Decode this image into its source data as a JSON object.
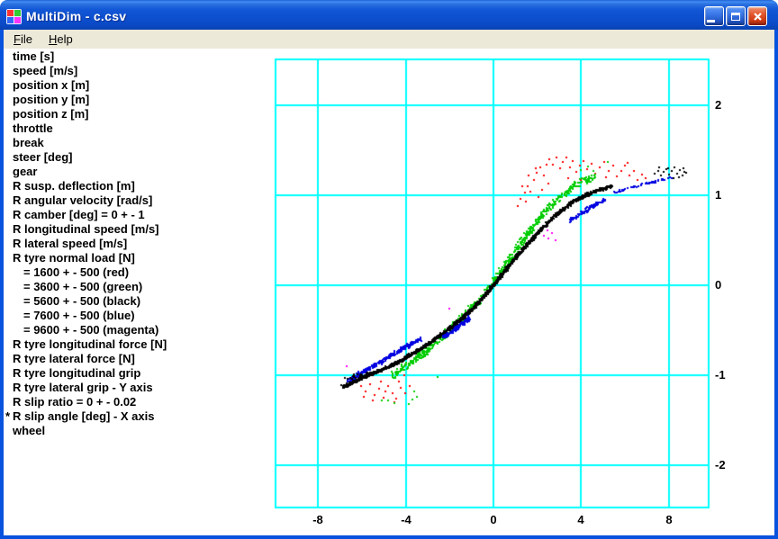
{
  "window": {
    "title": "MultiDim - c.csv",
    "icon_colors": [
      "#ff3333",
      "#33cc33",
      "#3366ff",
      "#ff33ff"
    ],
    "controls": [
      {
        "name": "minimize",
        "glyph": "underscore"
      },
      {
        "name": "maximize",
        "glyph": "square"
      },
      {
        "name": "close",
        "glyph": "x"
      }
    ]
  },
  "menubar": {
    "items": [
      {
        "label": "File"
      },
      {
        "label": "Help"
      }
    ]
  },
  "channel_list": {
    "items": [
      {
        "label": "time [s]",
        "indent": 0,
        "marker": ""
      },
      {
        "label": "speed [m/s]",
        "indent": 0,
        "marker": ""
      },
      {
        "label": "position x [m]",
        "indent": 0,
        "marker": ""
      },
      {
        "label": "position y [m]",
        "indent": 0,
        "marker": ""
      },
      {
        "label": "position z [m]",
        "indent": 0,
        "marker": ""
      },
      {
        "label": "throttle",
        "indent": 0,
        "marker": ""
      },
      {
        "label": "break",
        "indent": 0,
        "marker": ""
      },
      {
        "label": "steer [deg]",
        "indent": 0,
        "marker": ""
      },
      {
        "label": "gear",
        "indent": 0,
        "marker": ""
      },
      {
        "label": "R susp. deflection [m]",
        "indent": 0,
        "marker": ""
      },
      {
        "label": "R angular velocity [rad/s]",
        "indent": 0,
        "marker": ""
      },
      {
        "label": "R camber [deg] = 0 + - 1",
        "indent": 0,
        "marker": ""
      },
      {
        "label": "R longitudinal speed [m/s]",
        "indent": 0,
        "marker": ""
      },
      {
        "label": "R lateral speed [m/s]",
        "indent": 0,
        "marker": ""
      },
      {
        "label": "R tyre normal load [N]",
        "indent": 0,
        "marker": ""
      },
      {
        "label": "= 1600 + - 500 (red)",
        "indent": 1,
        "marker": ""
      },
      {
        "label": "= 3600 + - 500 (green)",
        "indent": 1,
        "marker": ""
      },
      {
        "label": "= 5600 + - 500 (black)",
        "indent": 1,
        "marker": ""
      },
      {
        "label": "= 7600 + - 500 (blue)",
        "indent": 1,
        "marker": ""
      },
      {
        "label": "= 9600 + - 500 (magenta)",
        "indent": 1,
        "marker": ""
      },
      {
        "label": "R tyre longitudinal force [N]",
        "indent": 0,
        "marker": ""
      },
      {
        "label": "R tyre lateral force [N]",
        "indent": 0,
        "marker": ""
      },
      {
        "label": "R tyre longitudinal grip",
        "indent": 0,
        "marker": ""
      },
      {
        "label": "R tyre lateral grip - Y axis",
        "indent": 0,
        "marker": ""
      },
      {
        "label": "R slip ratio = 0 + - 0.02",
        "indent": 0,
        "marker": ""
      },
      {
        "label": "R slip angle [deg] - X axis",
        "indent": 0,
        "marker": "*"
      },
      {
        "label": "wheel",
        "indent": 0,
        "marker": ""
      }
    ]
  },
  "chart_data": {
    "type": "scatter",
    "x_axis_channel": "R slip angle [deg]",
    "y_axis_channel": "R tyre lateral grip",
    "xlim": [
      -10,
      10
    ],
    "ylim": [
      -2.5,
      2.5
    ],
    "x_ticks": [
      -8,
      -4,
      0,
      4,
      8
    ],
    "y_ticks": [
      2,
      1,
      0,
      -1,
      -2
    ],
    "grid": true,
    "grid_color": "#00ffff",
    "legend_position": "none",
    "series": [
      {
        "name": "R tyre normal load = 1600 + - 500 (red)",
        "color": "#ff0000",
        "points": [
          [
            1.1,
            0.88
          ],
          [
            1.25,
            0.96
          ],
          [
            1.42,
            1.03
          ],
          [
            1.58,
            1.1
          ],
          [
            1.7,
            1.04
          ],
          [
            1.84,
            1.17
          ],
          [
            1.98,
            1.25
          ],
          [
            2.12,
            1.31
          ],
          [
            2.28,
            1.22
          ],
          [
            2.42,
            1.34
          ],
          [
            2.55,
            1.4
          ],
          [
            2.7,
            1.34
          ],
          [
            2.88,
            1.42
          ],
          [
            3.02,
            1.3
          ],
          [
            3.18,
            1.37
          ],
          [
            3.33,
            1.42
          ],
          [
            3.48,
            1.31
          ],
          [
            3.62,
            1.38
          ],
          [
            3.78,
            1.26
          ],
          [
            3.94,
            1.33
          ],
          [
            4.1,
            1.38
          ],
          [
            4.28,
            1.29
          ],
          [
            4.47,
            1.35
          ],
          [
            4.65,
            1.24
          ],
          [
            4.85,
            1.31
          ],
          [
            5.05,
            1.37
          ],
          [
            5.25,
            1.27
          ],
          [
            5.45,
            1.33
          ],
          [
            5.63,
            1.21
          ],
          [
            5.82,
            1.27
          ],
          [
            6.0,
            1.33
          ],
          [
            6.2,
            1.22
          ],
          [
            6.4,
            1.27
          ],
          [
            6.58,
            1.17
          ],
          [
            6.78,
            1.23
          ],
          [
            6.95,
            1.19
          ],
          [
            1.32,
            1.1
          ],
          [
            1.62,
            1.22
          ],
          [
            1.92,
            1.3
          ],
          [
            2.2,
            1.06
          ],
          [
            2.52,
            1.13
          ],
          [
            3.4,
            1.19
          ],
          [
            4.0,
            1.17
          ],
          [
            2.06,
            0.98
          ],
          [
            1.46,
            0.93
          ],
          [
            5.15,
            1.2
          ],
          [
            6.1,
            1.36
          ],
          [
            -6.05,
            -1.12
          ],
          [
            -5.85,
            -1.18
          ],
          [
            -5.62,
            -1.1
          ],
          [
            -5.42,
            -1.22
          ],
          [
            -5.2,
            -1.15
          ],
          [
            -5.0,
            -1.25
          ],
          [
            -4.82,
            -1.12
          ],
          [
            -4.62,
            -1.2
          ],
          [
            -4.42,
            -1.26
          ],
          [
            -4.22,
            -1.14
          ],
          [
            -4.02,
            -1.2
          ],
          [
            -3.82,
            -1.12
          ],
          [
            -5.52,
            -1.28
          ],
          [
            -4.92,
            -1.18
          ],
          [
            -4.32,
            -1.07
          ],
          [
            -5.12,
            -1.07
          ],
          [
            -5.92,
            -1.24
          ],
          [
            -4.52,
            -1.3
          ],
          [
            -4.05,
            -1.0
          ]
        ],
        "parts": []
      },
      {
        "name": "R tyre normal load = 9600 + - 500 (magenta)",
        "color": "#ff00ff",
        "points": [
          [
            -6.7,
            -0.9
          ],
          [
            -6.15,
            -0.96
          ],
          [
            -2.0,
            -0.26
          ],
          [
            2.3,
            0.55
          ],
          [
            2.5,
            0.52
          ],
          [
            2.65,
            0.58
          ],
          [
            2.85,
            0.5
          ],
          [
            2.45,
            0.61
          ]
        ],
        "parts": []
      },
      {
        "name": "R tyre normal load = 3600 + - 500 (green)",
        "color": "#00cc00",
        "points": [
          [
            -3.6,
            -1.18
          ],
          [
            -3.7,
            -1.27
          ],
          [
            -3.85,
            -1.32
          ],
          [
            -3.5,
            -1.24
          ],
          [
            -4.8,
            -1.28
          ],
          [
            -5.1,
            -1.28
          ],
          [
            -4.5,
            -1.31
          ],
          [
            4.0,
            1.28
          ],
          [
            4.3,
            1.32
          ],
          [
            4.55,
            1.27
          ],
          [
            5.2,
            1.37
          ],
          [
            -2.55,
            -1.02
          ]
        ],
        "parts": [
          {
            "backbone": [
              [
                -4.6,
                -1.0
              ],
              [
                -4.2,
                -0.94
              ],
              [
                -3.8,
                -0.87
              ],
              [
                -3.4,
                -0.8
              ],
              [
                -3.0,
                -0.72
              ],
              [
                -2.6,
                -0.63
              ],
              [
                -2.2,
                -0.54
              ],
              [
                -1.8,
                -0.45
              ],
              [
                -1.4,
                -0.36
              ],
              [
                -1.0,
                -0.26
              ],
              [
                -0.6,
                -0.15
              ],
              [
                -0.2,
                -0.04
              ],
              [
                0.2,
                0.1
              ],
              [
                0.6,
                0.24
              ],
              [
                1.0,
                0.38
              ],
              [
                1.4,
                0.52
              ],
              [
                1.8,
                0.65
              ],
              [
                2.2,
                0.77
              ],
              [
                2.6,
                0.88
              ],
              [
                3.0,
                0.97
              ],
              [
                3.4,
                1.05
              ],
              [
                3.8,
                1.12
              ],
              [
                4.2,
                1.17
              ],
              [
                4.6,
                1.2
              ]
            ],
            "n": 650,
            "jitter_x": 0.12,
            "jitter_y": 0.055
          }
        ]
      },
      {
        "name": "R tyre normal load = 7600 + - 500 (blue)",
        "color": "#0000e0",
        "points": [],
        "parts": [
          {
            "backbone": [
              [
                -6.6,
                -1.06
              ],
              [
                -6.3,
                -1.02
              ],
              [
                -6.0,
                -0.97
              ],
              [
                -5.6,
                -0.92
              ],
              [
                -5.2,
                -0.86
              ],
              [
                -4.8,
                -0.8
              ],
              [
                -4.4,
                -0.74
              ],
              [
                -4.0,
                -0.68
              ],
              [
                -3.6,
                -0.63
              ],
              [
                -3.3,
                -0.59
              ]
            ],
            "n": 260,
            "jitter_x": 0.1,
            "jitter_y": 0.03
          },
          {
            "backbone": [
              [
                -2.3,
                -0.57
              ],
              [
                -1.9,
                -0.51
              ],
              [
                -1.5,
                -0.44
              ],
              [
                -1.1,
                -0.37
              ]
            ],
            "n": 120,
            "jitter_x": 0.08,
            "jitter_y": 0.035
          },
          {
            "backbone": [
              [
                3.5,
                0.72
              ],
              [
                3.9,
                0.78
              ],
              [
                4.3,
                0.84
              ],
              [
                4.7,
                0.9
              ],
              [
                5.1,
                0.95
              ]
            ],
            "n": 90,
            "jitter_x": 0.08,
            "jitter_y": 0.03
          },
          {
            "backbone": [
              [
                5.5,
                1.03
              ],
              [
                5.9,
                1.06
              ],
              [
                6.3,
                1.09
              ],
              [
                6.8,
                1.12
              ],
              [
                7.3,
                1.15
              ],
              [
                7.8,
                1.18
              ],
              [
                8.1,
                1.2
              ]
            ],
            "n": 60,
            "jitter_x": 0.06,
            "jitter_y": 0.015
          }
        ]
      },
      {
        "name": "R tyre normal load = 5600 + - 500 (black)",
        "color": "#000000",
        "points": [
          [
            7.35,
            1.24
          ],
          [
            7.5,
            1.27
          ],
          [
            7.62,
            1.22
          ],
          [
            7.75,
            1.26
          ],
          [
            7.88,
            1.29
          ],
          [
            8.0,
            1.23
          ],
          [
            8.12,
            1.27
          ],
          [
            8.25,
            1.31
          ],
          [
            8.38,
            1.24
          ],
          [
            8.5,
            1.28
          ],
          [
            8.62,
            1.22
          ],
          [
            8.72,
            1.26
          ],
          [
            8.45,
            1.2
          ],
          [
            7.95,
            1.3
          ],
          [
            8.2,
            1.19
          ],
          [
            7.55,
            1.31
          ],
          [
            8.65,
            1.3
          ],
          [
            8.8,
            1.25
          ]
        ],
        "parts": [
          {
            "backbone": [
              [
                -6.9,
                -1.13
              ],
              [
                -6.4,
                -1.08
              ],
              [
                -5.9,
                -1.02
              ],
              [
                -5.4,
                -0.97
              ],
              [
                -4.9,
                -0.92
              ],
              [
                -4.4,
                -0.86
              ],
              [
                -3.9,
                -0.79
              ],
              [
                -3.4,
                -0.72
              ],
              [
                -2.9,
                -0.64
              ],
              [
                -2.4,
                -0.55
              ],
              [
                -1.9,
                -0.46
              ],
              [
                -1.4,
                -0.36
              ],
              [
                -0.9,
                -0.25
              ],
              [
                -0.4,
                -0.12
              ],
              [
                0.1,
                0.03
              ],
              [
                0.6,
                0.18
              ],
              [
                1.1,
                0.33
              ],
              [
                1.6,
                0.47
              ],
              [
                2.1,
                0.6
              ],
              [
                2.6,
                0.72
              ],
              [
                3.1,
                0.83
              ],
              [
                3.6,
                0.92
              ],
              [
                4.1,
                0.99
              ],
              [
                4.6,
                1.04
              ],
              [
                5.1,
                1.08
              ],
              [
                5.4,
                1.1
              ]
            ],
            "n": 1700,
            "jitter_x": 0.07,
            "jitter_y": 0.022
          },
          {
            "backbone": [
              [
                -6.7,
                -1.04
              ],
              [
                -6.1,
                -1.0
              ],
              [
                -5.6,
                -0.98
              ]
            ],
            "n": 25,
            "jitter_x": 0.12,
            "jitter_y": 0.03
          }
        ]
      }
    ]
  }
}
